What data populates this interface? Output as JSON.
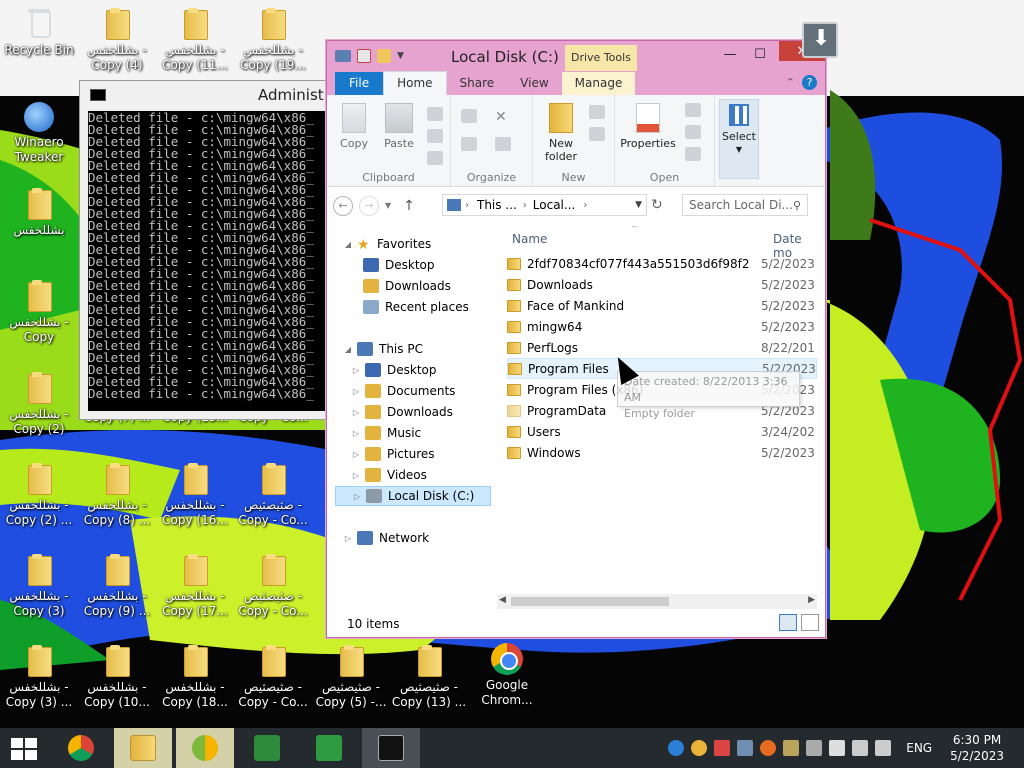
{
  "desktop": {
    "icons": [
      {
        "label": "Recycle Bin",
        "kind": "bin"
      },
      {
        "label": "بشللخفس -\nCopy (4)",
        "kind": "folder"
      },
      {
        "label": "بشللخفس -\nCopy (11...",
        "kind": "folder"
      },
      {
        "label": "بشللخفس -\nCopy (19...",
        "kind": "folder"
      },
      {
        "label": "Winaero\nTweaker",
        "kind": "tweaker"
      },
      {
        "label": "بشللخفس",
        "kind": "folder"
      },
      {
        "label": "بشللخفس -\nCopy",
        "kind": "folder"
      },
      {
        "label": "بشللخفس -\nCopy (2)",
        "kind": "folder"
      },
      {
        "label": "Copy (7) ...",
        "kind": "none"
      },
      {
        "label": "Copy (15...",
        "kind": "none"
      },
      {
        "label": "Copy - Co...",
        "kind": "none"
      },
      {
        "label": "بشللخفس -\nCopy (2) ...",
        "kind": "folder"
      },
      {
        "label": "بشللخفس -\nCopy (8) ...",
        "kind": "folder"
      },
      {
        "label": "بشللخفس -\nCopy (16...",
        "kind": "folder"
      },
      {
        "label": "صثيصثيص -\nCopy - Co...",
        "kind": "folder"
      },
      {
        "label": "بشللخفس -\nCopy (3)",
        "kind": "folder"
      },
      {
        "label": "بشللخفس -\nCopy (9) ...",
        "kind": "folder"
      },
      {
        "label": "بشللخفس -\nCopy (17...",
        "kind": "folder"
      },
      {
        "label": "صثيصثيص -\nCopy - Co...",
        "kind": "folder"
      },
      {
        "label": "بشللخفس -\nCopy (3) ...",
        "kind": "folder"
      },
      {
        "label": "بشللخفس -\nCopy (10...",
        "kind": "folder"
      },
      {
        "label": "بشللخفس -\nCopy (18...",
        "kind": "folder"
      },
      {
        "label": "صثيصثيص -\nCopy - Co...",
        "kind": "folder"
      },
      {
        "label": "صثيصثيص -\nCopy (5) -...",
        "kind": "folder"
      },
      {
        "label": "صثيصثيص -\nCopy (13) ...",
        "kind": "folder"
      },
      {
        "label": "Google\nChrom...",
        "kind": "chrome"
      }
    ]
  },
  "cmd": {
    "title": "Administra",
    "lines": [
      "Deleted file - c:\\mingw64\\x86_",
      "Deleted file - c:\\mingw64\\x86_",
      "Deleted file - c:\\mingw64\\x86_",
      "Deleted file - c:\\mingw64\\x86_",
      "Deleted file - c:\\mingw64\\x86_",
      "Deleted file - c:\\mingw64\\x86_",
      "Deleted file - c:\\mingw64\\x86_",
      "Deleted file - c:\\mingw64\\x86_",
      "Deleted file - c:\\mingw64\\x86_",
      "Deleted file - c:\\mingw64\\x86_",
      "Deleted file - c:\\mingw64\\x86_",
      "Deleted file - c:\\mingw64\\x86_",
      "Deleted file - c:\\mingw64\\x86_",
      "Deleted file - c:\\mingw64\\x86_",
      "Deleted file - c:\\mingw64\\x86_",
      "Deleted file - c:\\mingw64\\x86_",
      "Deleted file - c:\\mingw64\\x86_",
      "Deleted file - c:\\mingw64\\x86_",
      "Deleted file - c:\\mingw64\\x86_",
      "Deleted file - c:\\mingw64\\x86_",
      "Deleted file - c:\\mingw64\\x86_",
      "Deleted file - c:\\mingw64\\x86_",
      "Deleted file - c:\\mingw64\\x86_",
      "Deleted file - c:\\mingw64\\x86_"
    ]
  },
  "explorer": {
    "title": "Local Disk (C:)",
    "context_tab": "Drive Tools",
    "window_buttons": {
      "minimize": "—",
      "maximize": "☐",
      "close": "✕"
    },
    "tabs": {
      "file": "File",
      "home": "Home",
      "share": "Share",
      "view": "View",
      "manage": "Manage"
    },
    "help": "?",
    "ribbon": {
      "clipboard": {
        "copy": "Copy",
        "paste": "Paste",
        "group": "Clipboard"
      },
      "organize": {
        "group": "Organize"
      },
      "new": {
        "new_folder": "New\nfolder",
        "group": "New"
      },
      "open": {
        "properties": "Properties",
        "group": "Open"
      },
      "select": {
        "select": "Select"
      }
    },
    "address": {
      "crumb1": "This ...",
      "crumb2": "Local...",
      "search_placeholder": "Search Local Di..."
    },
    "nav": {
      "favorites": "Favorites",
      "desktop": "Desktop",
      "downloads": "Downloads",
      "recent": "Recent places",
      "this_pc": "This PC",
      "pc_desktop": "Desktop",
      "documents": "Documents",
      "pc_downloads": "Downloads",
      "music": "Music",
      "pictures": "Pictures",
      "videos": "Videos",
      "local_disk": "Local Disk (C:)",
      "network": "Network"
    },
    "columns": {
      "name": "Name",
      "date": "Date mo"
    },
    "files": [
      {
        "name": "2fdf70834cf077f443a551503d6f98f2",
        "date": "5/2/2023"
      },
      {
        "name": "Downloads",
        "date": "5/2/2023"
      },
      {
        "name": "Face of Mankind",
        "date": "5/2/2023"
      },
      {
        "name": "mingw64",
        "date": "5/2/2023"
      },
      {
        "name": "PerfLogs",
        "date": "8/22/201"
      },
      {
        "name": "Program Files",
        "date": "5/2/2023"
      },
      {
        "name": "Program Files (x86)",
        "date": "5/2/2023"
      },
      {
        "name": "ProgramData",
        "date": "5/2/2023"
      },
      {
        "name": "Users",
        "date": "3/24/202"
      },
      {
        "name": "Windows",
        "date": "5/2/2023"
      }
    ],
    "tooltip": {
      "line1": "Date created: 8/22/2013 3:36 AM",
      "line2": "Empty folder"
    },
    "status": "10 items"
  },
  "taskbar": {
    "lang": "ENG",
    "time": "6:30 PM",
    "date": "5/2/2023"
  },
  "colors": {
    "explorer_frame": "#e7a3cf",
    "file_tab": "#1979ca",
    "taskbar": "#252a2f",
    "folder": "#f0c75a"
  }
}
